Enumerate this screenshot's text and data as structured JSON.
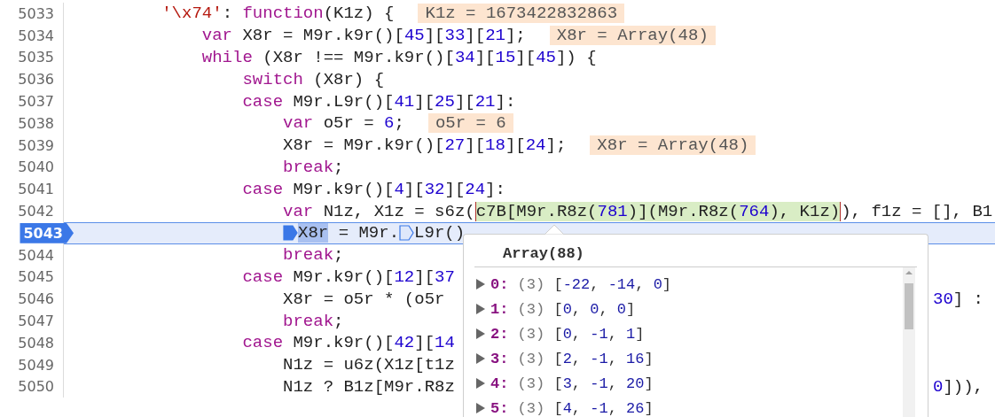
{
  "editor": {
    "lines": [
      {
        "number": "5033",
        "current": false,
        "tokens": [
          {
            "kind": "str",
            "text": "'\\x74'"
          },
          {
            "kind": "plain",
            "text": ": "
          },
          {
            "kind": "kw",
            "text": "function"
          },
          {
            "kind": "plain",
            "text": "(K1z) {"
          }
        ],
        "inline_value": "K1z = 1673422832863",
        "children": [
          {
            "number": "5034",
            "current": false,
            "tokens": [
              {
                "kind": "kw",
                "text": "var"
              },
              {
                "kind": "plain",
                "text": " X8r = M9r.k9r()["
              },
              {
                "kind": "num",
                "text": "45"
              },
              {
                "kind": "plain",
                "text": "]["
              },
              {
                "kind": "num",
                "text": "33"
              },
              {
                "kind": "plain",
                "text": "]["
              },
              {
                "kind": "num",
                "text": "21"
              },
              {
                "kind": "plain",
                "text": "];"
              }
            ],
            "inline_value": "X8r = Array(48)"
          },
          {
            "number": "5035",
            "current": false,
            "tokens": [
              {
                "kind": "kw",
                "text": "while"
              },
              {
                "kind": "plain",
                "text": " (X8r !== M9r.k9r()["
              },
              {
                "kind": "num",
                "text": "34"
              },
              {
                "kind": "plain",
                "text": "]["
              },
              {
                "kind": "num",
                "text": "15"
              },
              {
                "kind": "plain",
                "text": "]["
              },
              {
                "kind": "num",
                "text": "45"
              },
              {
                "kind": "plain",
                "text": "]) {"
              }
            ],
            "children": [
              {
                "number": "5036",
                "current": false,
                "tokens": [
                  {
                    "kind": "kw",
                    "text": "switch"
                  },
                  {
                    "kind": "plain",
                    "text": " (X8r) {"
                  }
                ]
              },
              {
                "number": "5037",
                "current": false,
                "tokens": [
                  {
                    "kind": "kw",
                    "text": "case"
                  },
                  {
                    "kind": "plain",
                    "text": " M9r.L9r()["
                  },
                  {
                    "kind": "num",
                    "text": "41"
                  },
                  {
                    "kind": "plain",
                    "text": "]["
                  },
                  {
                    "kind": "num",
                    "text": "25"
                  },
                  {
                    "kind": "plain",
                    "text": "]["
                  },
                  {
                    "kind": "num",
                    "text": "21"
                  },
                  {
                    "kind": "plain",
                    "text": "]:"
                  }
                ],
                "children": [
                  {
                    "number": "5038",
                    "current": false,
                    "tokens": [
                      {
                        "kind": "kw",
                        "text": "var"
                      },
                      {
                        "kind": "plain",
                        "text": " o5r = "
                      },
                      {
                        "kind": "num",
                        "text": "6"
                      },
                      {
                        "kind": "plain",
                        "text": ";"
                      }
                    ],
                    "inline_value": "o5r = 6"
                  },
                  {
                    "number": "5039",
                    "current": false,
                    "tokens": [
                      {
                        "kind": "plain",
                        "text": "X8r = M9r.k9r()["
                      },
                      {
                        "kind": "num",
                        "text": "27"
                      },
                      {
                        "kind": "plain",
                        "text": "]["
                      },
                      {
                        "kind": "num",
                        "text": "18"
                      },
                      {
                        "kind": "plain",
                        "text": "]["
                      },
                      {
                        "kind": "num",
                        "text": "24"
                      },
                      {
                        "kind": "plain",
                        "text": "];"
                      }
                    ],
                    "inline_value": "X8r = Array(48)"
                  },
                  {
                    "number": "5040",
                    "current": false,
                    "tokens": [
                      {
                        "kind": "kw",
                        "text": "break"
                      },
                      {
                        "kind": "plain",
                        "text": ";"
                      }
                    ]
                  }
                ]
              },
              {
                "number": "5041",
                "current": false,
                "tokens": [
                  {
                    "kind": "kw",
                    "text": "case"
                  },
                  {
                    "kind": "plain",
                    "text": " M9r.k9r()["
                  },
                  {
                    "kind": "num",
                    "text": "4"
                  },
                  {
                    "kind": "plain",
                    "text": "]["
                  },
                  {
                    "kind": "num",
                    "text": "32"
                  },
                  {
                    "kind": "plain",
                    "text": "]["
                  },
                  {
                    "kind": "num",
                    "text": "24"
                  },
                  {
                    "kind": "plain",
                    "text": "]:"
                  }
                ],
                "children": [
                  {
                    "number": "5042",
                    "current": false,
                    "tokens": [
                      {
                        "kind": "kw",
                        "text": "var"
                      },
                      {
                        "kind": "plain",
                        "text": " N1z, X1z = s6z("
                      },
                      {
                        "kind": "group",
                        "tokens": [
                          {
                            "kind": "plain",
                            "text": "c7B[M9r.R8z("
                          },
                          {
                            "kind": "num",
                            "text": "781"
                          },
                          {
                            "kind": "plain",
                            "text": ")](M9r.R8z("
                          },
                          {
                            "kind": "num",
                            "text": "764"
                          },
                          {
                            "kind": "plain",
                            "text": "), K1z)"
                          }
                        ]
                      },
                      {
                        "kind": "plain",
                        "text": "), f1z = [], B1"
                      }
                    ]
                  },
                  {
                    "number": "5043",
                    "current": true,
                    "tokens": [
                      {
                        "kind": "marker",
                        "current": true
                      },
                      {
                        "kind": "sel",
                        "text": "X8r"
                      },
                      {
                        "kind": "plain",
                        "text": " = M9r."
                      },
                      {
                        "kind": "marker",
                        "current": false
                      },
                      {
                        "kind": "plain",
                        "text": "L9r()"
                      }
                    ]
                  },
                  {
                    "number": "5044",
                    "current": false,
                    "tokens": [
                      {
                        "kind": "kw",
                        "text": "break"
                      },
                      {
                        "kind": "plain",
                        "text": ";"
                      }
                    ]
                  }
                ]
              },
              {
                "number": "5045",
                "current": false,
                "tokens": [
                  {
                    "kind": "kw",
                    "text": "case"
                  },
                  {
                    "kind": "plain",
                    "text": " M9r.k9r()["
                  },
                  {
                    "kind": "num",
                    "text": "12"
                  },
                  {
                    "kind": "plain",
                    "text": "]["
                  },
                  {
                    "kind": "num",
                    "text": "37"
                  }
                ],
                "children": [
                  {
                    "number": "5046",
                    "current": false,
                    "tokens": [
                      {
                        "kind": "plain",
                        "text": "X8r = o5r * (o5r"
                      }
                    ],
                    "tail": [
                      {
                        "kind": "num",
                        "text": "30"
                      },
                      {
                        "kind": "plain",
                        "text": "] :"
                      }
                    ]
                  },
                  {
                    "number": "5047",
                    "current": false,
                    "tokens": [
                      {
                        "kind": "kw",
                        "text": "break"
                      },
                      {
                        "kind": "plain",
                        "text": ";"
                      }
                    ]
                  }
                ]
              },
              {
                "number": "5048",
                "current": false,
                "tokens": [
                  {
                    "kind": "kw",
                    "text": "case"
                  },
                  {
                    "kind": "plain",
                    "text": " M9r.k9r()["
                  },
                  {
                    "kind": "num",
                    "text": "42"
                  },
                  {
                    "kind": "plain",
                    "text": "]["
                  },
                  {
                    "kind": "num",
                    "text": "14"
                  }
                ],
                "children": [
                  {
                    "number": "5049",
                    "current": false,
                    "tokens": [
                      {
                        "kind": "plain",
                        "text": "N1z = u6z(X1z[t1z"
                      }
                    ]
                  },
                  {
                    "number": "5050",
                    "current": false,
                    "tokens": [
                      {
                        "kind": "plain",
                        "text": "N1z ? B1z[M9r.R8z"
                      }
                    ],
                    "tail": [
                      {
                        "kind": "num",
                        "text": "0"
                      },
                      {
                        "kind": "plain",
                        "text": "])),"
                      }
                    ]
                  }
                ]
              }
            ]
          }
        ]
      }
    ]
  },
  "popover": {
    "title": "Array(88)",
    "rows": [
      {
        "label": "0:",
        "count": "(3)",
        "value": "[-22, -14, 0]",
        "expanded": false
      },
      {
        "label": "1:",
        "count": "(3)",
        "value": "[0, 0, 0]",
        "expanded": false
      },
      {
        "label": "2:",
        "count": "(3)",
        "value": "[0, -1, 1]",
        "expanded": false
      },
      {
        "label": "3:",
        "count": "(3)",
        "value": "[2, -1, 16]",
        "expanded": false
      },
      {
        "label": "4:",
        "count": "(3)",
        "value": "[3, -1, 20]",
        "expanded": false
      },
      {
        "label": "5:",
        "count": "(3)",
        "value": "[4, -1, 26]",
        "expanded": false
      }
    ]
  }
}
